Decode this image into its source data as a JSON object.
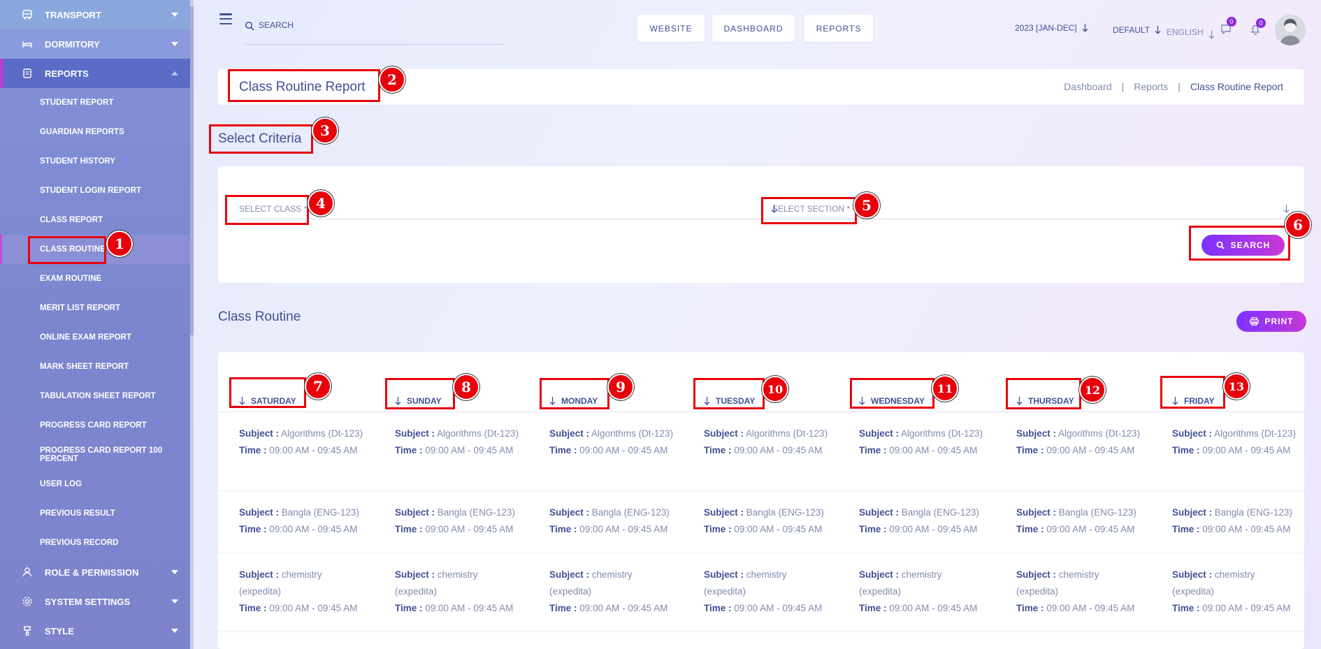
{
  "sidebar": {
    "items_top": [
      {
        "label": "TRANSPORT",
        "icon": "bus-icon"
      },
      {
        "label": "DORMITORY",
        "icon": "bed-icon"
      },
      {
        "label": "REPORTS",
        "icon": "report-icon"
      }
    ],
    "reports_sub": [
      "STUDENT REPORT",
      "GUARDIAN REPORTS",
      "STUDENT HISTORY",
      "STUDENT LOGIN REPORT",
      "CLASS REPORT",
      "CLASS ROUTINE",
      "EXAM ROUTINE",
      "MERIT LIST REPORT",
      "ONLINE EXAM REPORT",
      "MARK SHEET REPORT",
      "TABULATION SHEET REPORT",
      "PROGRESS CARD REPORT",
      "PROGRESS CARD REPORT 100 PERCENT",
      "USER LOG",
      "PREVIOUS RESULT",
      "PREVIOUS RECORD"
    ],
    "active_sub": "CLASS ROUTINE",
    "items_bottom": [
      {
        "label": "ROLE & PERMISSION",
        "icon": "role-icon"
      },
      {
        "label": "SYSTEM SETTINGS",
        "icon": "settings-icon"
      },
      {
        "label": "STYLE",
        "icon": "style-icon"
      }
    ]
  },
  "header": {
    "search_placeholder": "SEARCH",
    "buttons": [
      "WEBSITE",
      "DASHBOARD",
      "REPORTS"
    ],
    "session": "2023 [JAN-DEC]",
    "theme": "DEFAULT",
    "language": "ENGLISH",
    "messages_count": "0",
    "notifications_count": "0"
  },
  "page": {
    "title": "Class Routine Report",
    "breadcrumb": [
      "Dashboard",
      "Reports",
      "Class Routine Report"
    ]
  },
  "criteria": {
    "title": "Select Criteria",
    "class_placeholder": "SELECT CLASS *",
    "section_placeholder": "SELECT SECTION *",
    "search_label": "SEARCH"
  },
  "routine": {
    "title": "Class Routine",
    "print_label": "PRINT",
    "days": [
      "SATURDAY",
      "SUNDAY",
      "MONDAY",
      "TUESDAY",
      "WEDNESDAY",
      "THURSDAY",
      "FRIDAY"
    ],
    "subject_label": "Subject :",
    "time_label": "Time :",
    "rows": [
      {
        "subject": "Algorithms (Dt-123)",
        "time": "09:00 AM - 09:45 AM"
      },
      {
        "subject": "Bangla (ENG-123)",
        "time": "09:00 AM - 09:45 AM"
      },
      {
        "subject": "chemistry (expedita)",
        "time": "09:00 AM - 09:45 AM"
      }
    ]
  },
  "annotations": [
    "1",
    "2",
    "3",
    "4",
    "5",
    "6",
    "7",
    "8",
    "9",
    "10",
    "11",
    "12",
    "13"
  ],
  "colors": {
    "accent": "#7c32ff",
    "accent2": "#c738d8",
    "text": "#415094",
    "annotation": "#e8000b"
  }
}
